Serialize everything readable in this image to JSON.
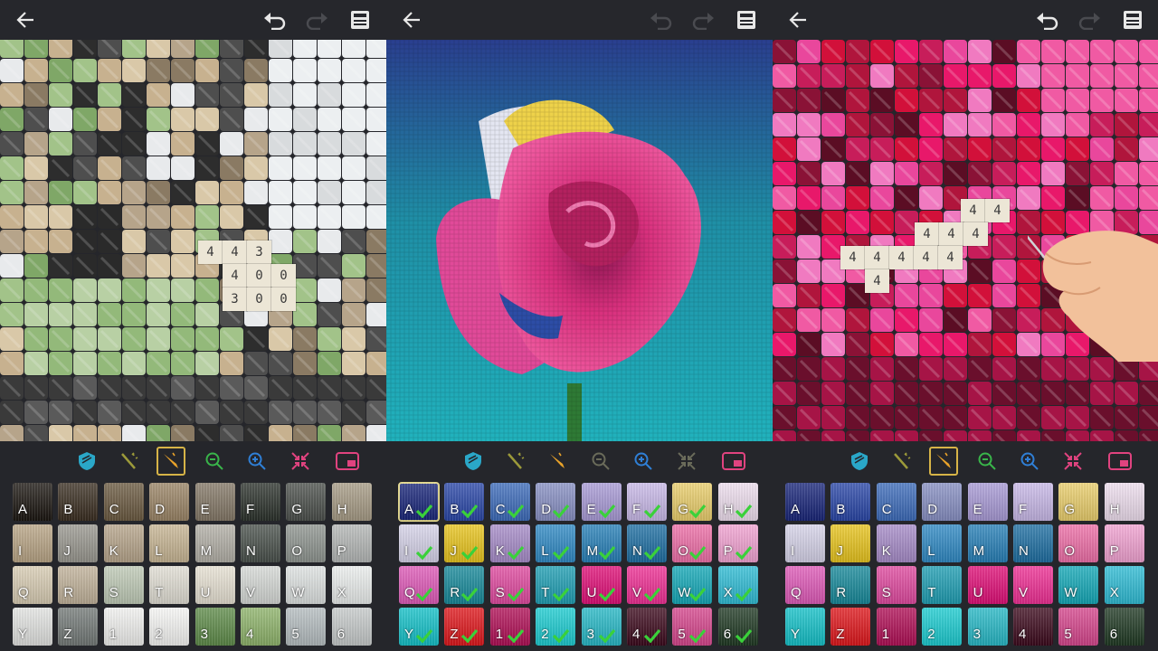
{
  "toolbar_icons": [
    "back-arrow-icon",
    "undo-icon",
    "redo-icon",
    "save-icon"
  ],
  "tools": [
    "shield-icon",
    "magic-wand-icon",
    "pen-icon",
    "zoom-out-icon",
    "zoom-in-icon",
    "collapse-icon",
    "minimap-icon"
  ],
  "palette_labels": [
    "A",
    "B",
    "C",
    "D",
    "E",
    "F",
    "G",
    "H",
    "I",
    "J",
    "K",
    "L",
    "M",
    "N",
    "O",
    "P",
    "Q",
    "R",
    "S",
    "T",
    "U",
    "V",
    "W",
    "X",
    "Y",
    "Z",
    "1",
    "2",
    "3",
    "4",
    "5",
    "6"
  ],
  "panel1": {
    "numbers": [
      [
        "4",
        "4",
        "3"
      ],
      [
        "4",
        "0",
        "0"
      ],
      [
        "3",
        "0",
        "0"
      ]
    ],
    "palette_colors": [
      "#1c1712",
      "#3b2f22",
      "#6b5a41",
      "#9b8566",
      "#847867",
      "#2d332d",
      "#4c504c",
      "#a79c86",
      "#b9a586",
      "#9a9890",
      "#b7a58b",
      "#c8b694",
      "#b3b0a7",
      "#4a514c",
      "#8f9590",
      "#b5b8b7",
      "#d9cdb4",
      "#c2b39b",
      "#c0cbb7",
      "#e2dfd5",
      "#e8e2d4",
      "#d7dad7",
      "#dfe3e2",
      "#ecefee",
      "#e3e4e2",
      "#747a78",
      "#f2f2f0",
      "#f7f7f5",
      "#5f8c4a",
      "#8fb46b",
      "#b6bec1",
      "#c7cbcb"
    ]
  },
  "panel2": {
    "selected": "A",
    "palette_colors": [
      "#19267a",
      "#2a47a8",
      "#3d6cbb",
      "#8890c4",
      "#a99bd7",
      "#c9b9e9",
      "#ebcf6c",
      "#efdfef",
      "#d7d4ea",
      "#e9c51d",
      "#a78cc9",
      "#2f8ac5",
      "#2780b8",
      "#1e6fa3",
      "#ef6fa8",
      "#f3a3d3",
      "#e05ab9",
      "#178a9b",
      "#e14aa0",
      "#1f9fb4",
      "#e10f78",
      "#f02f95",
      "#14a9b8",
      "#2fbdd6",
      "#14c2c9",
      "#e0171c",
      "#b10f56",
      "#1ccdd2",
      "#27b9c7",
      "#3d0a1d",
      "#d7468d",
      "#203a24"
    ]
  },
  "panel3": {
    "numbers_row1": [
      "4",
      "4"
    ],
    "numbers_row2": [
      "4",
      "4",
      "4"
    ],
    "numbers_row3": [
      "4",
      "4",
      "4",
      "4",
      "4"
    ],
    "numbers_row4": [
      "4"
    ],
    "palette_colors": [
      "#19267a",
      "#2a47a8",
      "#3d6cbb",
      "#8890c4",
      "#a99bd7",
      "#c9b9e9",
      "#ebcf6c",
      "#efdfef",
      "#d7d4ea",
      "#e9c51d",
      "#a78cc9",
      "#2f8ac5",
      "#2780b8",
      "#1e6fa3",
      "#ef6fa8",
      "#f3a3d3",
      "#e05ab9",
      "#178a9b",
      "#e14aa0",
      "#1f9fb4",
      "#e10f78",
      "#f02f95",
      "#14a9b8",
      "#2fbdd6",
      "#14c2c9",
      "#e0171c",
      "#b10f56",
      "#1ccdd2",
      "#27b9c7",
      "#3d0a1d",
      "#d7468d",
      "#203a24"
    ]
  },
  "colors": {
    "accent_check": "#3ad13a",
    "active_tool_border": "#d7b447",
    "tool_teal": "#2aa7c8",
    "tool_olive": "#9c9a3a",
    "tool_orange": "#e8a22a",
    "tool_green": "#39b54a",
    "tool_blue": "#2f7fd6",
    "tool_pink": "#e0437f"
  }
}
